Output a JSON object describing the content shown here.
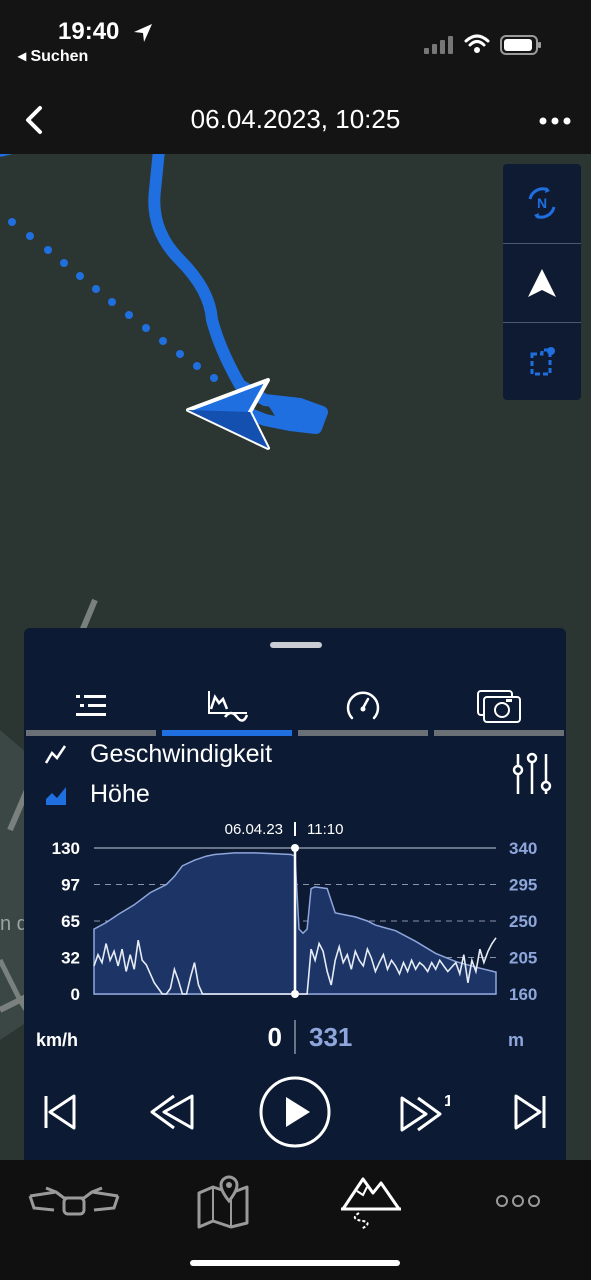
{
  "status_bar": {
    "time": "19:40",
    "back_app": "◂ Suchen"
  },
  "header": {
    "title": "06.04.2023, 10:25"
  },
  "map": {
    "label_fragment": "n d"
  },
  "map_tools": [
    "compass-north",
    "navigation-arrow",
    "route-area"
  ],
  "panel": {
    "tabs": [
      "list",
      "chart",
      "speedometer",
      "photos"
    ],
    "active_tab": 1,
    "legend": {
      "speed_label": "Geschwindigkeit",
      "elevation_label": "Höhe"
    },
    "chart_data": {
      "type": "area",
      "cursor": {
        "date": "06.04.23",
        "time": "11:10"
      },
      "y_left_ticks": [
        "130",
        "97",
        "65",
        "32",
        "0"
      ],
      "y_right_ticks": [
        "340",
        "295",
        "250",
        "205",
        "160"
      ],
      "y_left_range": [
        0,
        130
      ],
      "y_right_range": [
        160,
        340
      ],
      "x_range": [
        0,
        100
      ],
      "series": [
        {
          "name": "Geschwindigkeit",
          "unit": "km/h",
          "x": [
            0,
            1,
            2,
            3,
            4,
            5,
            6,
            7,
            8,
            9,
            10,
            11,
            12,
            13,
            14,
            15,
            16,
            17,
            18,
            19,
            20,
            21,
            22,
            23,
            24,
            25,
            26,
            27,
            28,
            29,
            30,
            31,
            32,
            33,
            34,
            35,
            36,
            37,
            38,
            39,
            40,
            41,
            42,
            43,
            44,
            45,
            46,
            47,
            48,
            49,
            50,
            51,
            52,
            53,
            54,
            55,
            56,
            57,
            58,
            59,
            60,
            61,
            62,
            63,
            64,
            65,
            66,
            67,
            68,
            69,
            70,
            71,
            72,
            73,
            74,
            75,
            76,
            77,
            78,
            79,
            80,
            81,
            82,
            83,
            84,
            85,
            86,
            87,
            88,
            89,
            90,
            91,
            92,
            93,
            94,
            95,
            96,
            97,
            98,
            99,
            100
          ],
          "values": [
            25,
            35,
            28,
            45,
            30,
            38,
            25,
            40,
            20,
            35,
            22,
            48,
            30,
            26,
            18,
            10,
            5,
            0,
            0,
            5,
            22,
            12,
            0,
            0,
            15,
            28,
            8,
            0,
            0,
            0,
            0,
            0,
            0,
            0,
            0,
            0,
            0,
            0,
            0,
            0,
            0,
            0,
            0,
            0,
            0,
            0,
            0,
            0,
            0,
            0,
            0,
            0,
            0,
            0,
            40,
            30,
            45,
            38,
            20,
            8,
            30,
            42,
            28,
            35,
            22,
            38,
            30,
            25,
            40,
            32,
            20,
            28,
            35,
            22,
            30,
            25,
            18,
            28,
            20,
            30,
            22,
            28,
            25,
            20,
            28,
            22,
            30,
            25,
            20,
            24,
            28,
            18,
            35,
            10,
            30,
            20,
            40,
            28,
            38,
            45,
            50
          ]
        },
        {
          "name": "Höhe",
          "unit": "m",
          "x": [
            0,
            3,
            6,
            10,
            14,
            18,
            20,
            22,
            25,
            28,
            30,
            35,
            40,
            45,
            49,
            50,
            51,
            52,
            53,
            54,
            55,
            58,
            60,
            62,
            65,
            68,
            70,
            75,
            80,
            85,
            90,
            95,
            100
          ],
          "values": [
            240,
            248,
            258,
            270,
            285,
            295,
            305,
            318,
            325,
            330,
            332,
            334,
            334,
            333,
            332,
            330,
            240,
            235,
            240,
            290,
            292,
            290,
            260,
            258,
            255,
            250,
            245,
            238,
            225,
            210,
            200,
            193,
            187
          ]
        }
      ],
      "cursor_values": {
        "speed": "0",
        "elevation": "331"
      },
      "units": {
        "left": "km/h",
        "right": "m"
      }
    },
    "controls": [
      "skip-to-start",
      "rewind",
      "play",
      "fast-forward-1x",
      "skip-to-end"
    ],
    "fast_forward_multiplier": "1"
  },
  "bottom_nav": [
    "motorcycle-handlebar",
    "map",
    "trips",
    "more"
  ],
  "colors": {
    "accent": "#1f6fe0",
    "panel": "#0c1a33",
    "elevation_fill": "#1c3566",
    "map_bg": "#2b3632"
  }
}
